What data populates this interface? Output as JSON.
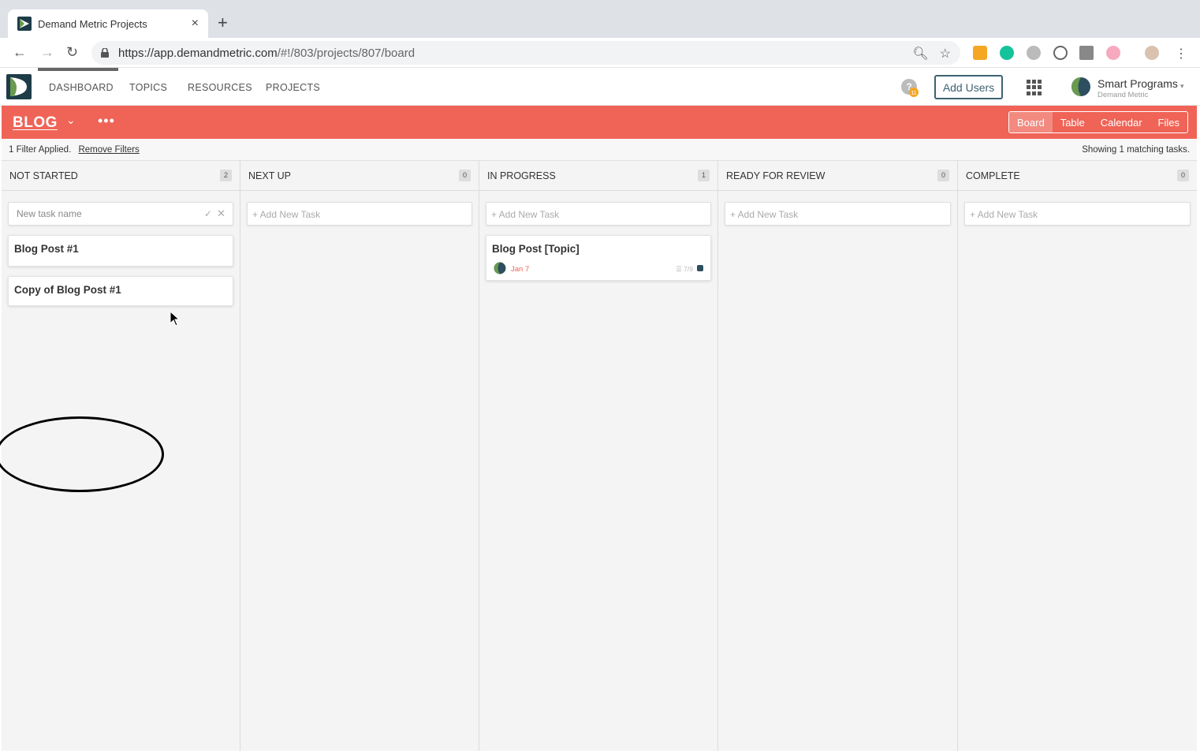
{
  "browser": {
    "tab_title": "Demand Metric Projects",
    "tab_close": "×",
    "new_tab": "+",
    "url_host": "https://app.demandmetric.com",
    "url_path": "/#!/803/projects/807/board"
  },
  "app": {
    "nav": [
      "DASHBOARD",
      "TOPICS",
      "RESOURCES",
      "PROJECTS"
    ],
    "help_badge": "11",
    "add_users_label": "Add Users",
    "org_name": "Smart Programs",
    "org_sub": "Demand Metric"
  },
  "project": {
    "name": "BLOG",
    "more": "•••",
    "views": [
      "Board",
      "Table",
      "Calendar",
      "Files"
    ],
    "active_view": "Board"
  },
  "filter": {
    "applied_text": "1 Filter Applied.",
    "remove_label": "Remove Filters",
    "showing_text": "Showing 1 matching tasks."
  },
  "columns": [
    {
      "title": "NOT STARTED",
      "count": "2",
      "new_task_placeholder": "New task name",
      "cards": [
        {
          "title": "Blog Post #1"
        },
        {
          "title": "Copy of Blog Post #1"
        }
      ]
    },
    {
      "title": "NEXT UP",
      "count": "0",
      "add_label": "+ Add New Task",
      "cards": []
    },
    {
      "title": "IN PROGRESS",
      "count": "1",
      "add_label": "+ Add New Task",
      "cards": [
        {
          "title": "Blog Post [Topic]",
          "date": "Jan 7",
          "checklist": "☰ 7/9"
        }
      ]
    },
    {
      "title": "READY FOR REVIEW",
      "count": "0",
      "add_label": "+ Add New Task",
      "cards": []
    },
    {
      "title": "COMPLETE",
      "count": "0",
      "add_label": "+ Add New Task",
      "cards": []
    }
  ],
  "colors": {
    "project_bar": "#f06357",
    "accent_dark": "#3d6272"
  }
}
